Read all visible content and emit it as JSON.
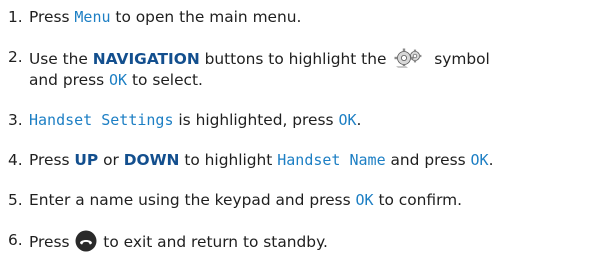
{
  "steps": [
    {
      "num": "1.",
      "a": "Press ",
      "menu": "Menu",
      "b": " to open the main menu."
    },
    {
      "num": "2.",
      "a": "Use the ",
      "nav": "NAVIGATION",
      "b": " buttons to highlight the ",
      "c": " symbol",
      "d": "and press ",
      "ok": "OK",
      "e": " to select."
    },
    {
      "num": "3.",
      "disp": "Handset Settings",
      "a": " is highlighted, press ",
      "ok": "OK",
      "b": "."
    },
    {
      "num": "4.",
      "a": "Press ",
      "up": "UP",
      "b": " or ",
      "down": "DOWN",
      "c": " to highlight ",
      "disp": "Handset Name",
      "d": " and press ",
      "ok": "OK",
      "e": "."
    },
    {
      "num": "5.",
      "a": "Enter a name using the keypad and press ",
      "ok": "OK",
      "b": " to confirm."
    },
    {
      "num": "6.",
      "a": "Press ",
      "b": " to exit and return to standby."
    }
  ],
  "icons": {
    "settings": "settings-gear-icon",
    "end_call": "end-call-icon"
  },
  "colors": {
    "display_text": "#1d7fc4",
    "key_text": "#134f8e",
    "body_text": "#1f1f1f"
  }
}
